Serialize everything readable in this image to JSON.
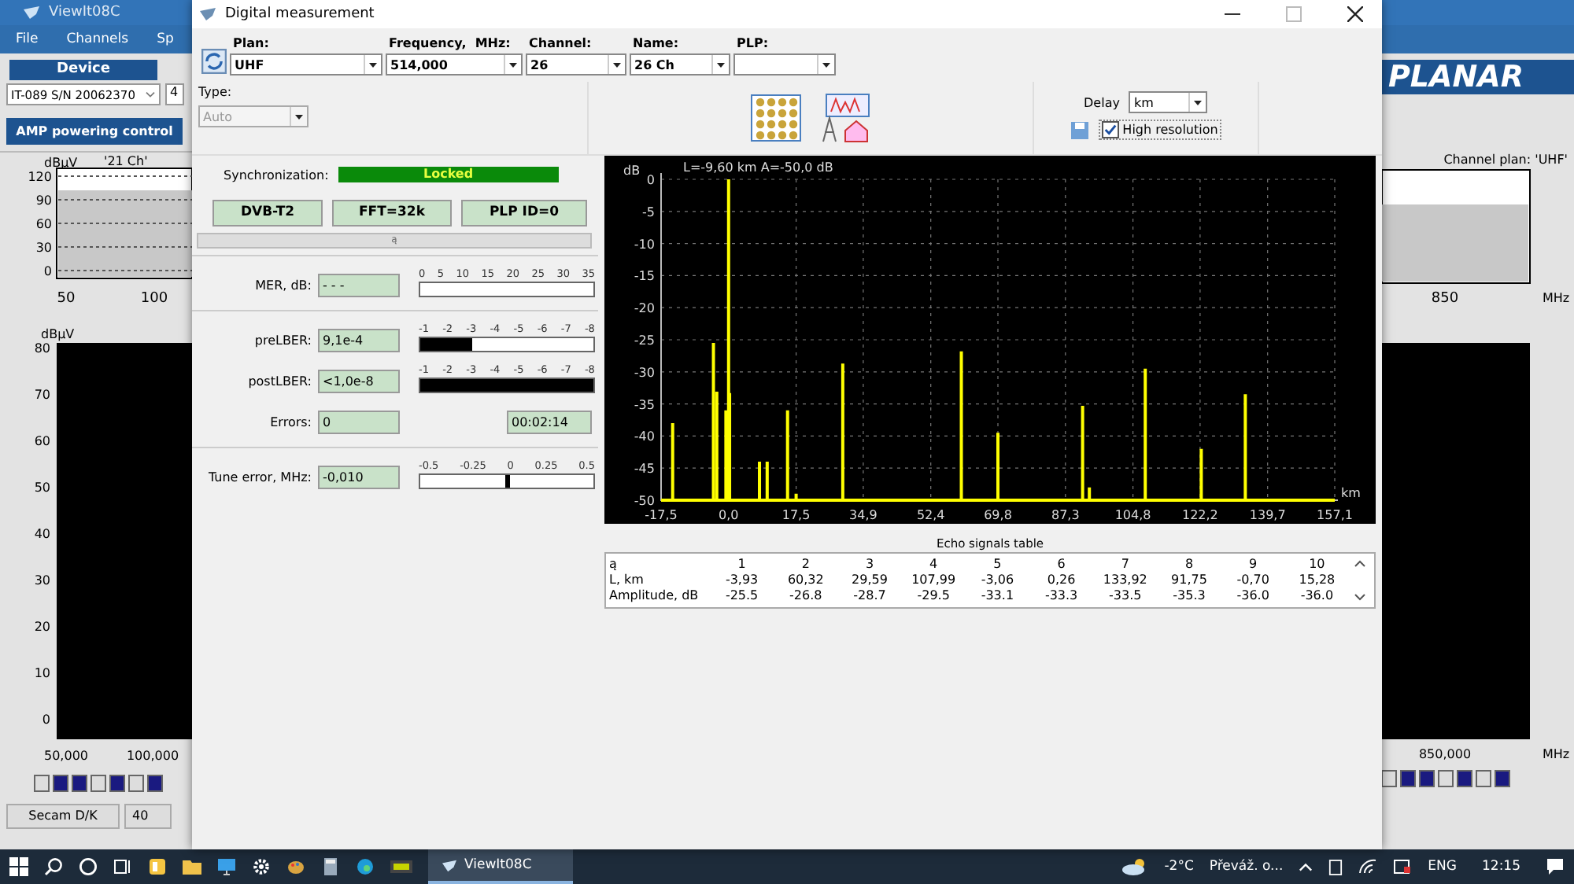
{
  "app": {
    "title": "ViewIt08C",
    "menu": [
      "File",
      "Channels",
      "Sp"
    ],
    "device_label": "Device",
    "device": "IT-089 S/N 20062370",
    "device_partial": "4",
    "amp_button": "AMP powering control",
    "left_spectrum": {
      "unit": "dBµV",
      "marker": "'21 Ch'",
      "yticks": [
        "120",
        "90",
        "60",
        "30",
        "0"
      ],
      "xticks": [
        "50",
        "100"
      ]
    },
    "left_levels": {
      "unit": "dBµV",
      "yticks": [
        "80",
        "70",
        "60",
        "50",
        "40",
        "30",
        "20",
        "10",
        "0"
      ],
      "xticks": [
        "50,000",
        "100,000"
      ]
    },
    "standard": "Secam D/K",
    "standard_partial": "40",
    "logo": "PLANAR",
    "channel_plan": "Channel plan: 'UHF'",
    "right_spectrum": {
      "xticks": [
        "850"
      ],
      "unit": "MHz"
    },
    "right_levels": {
      "xticks": [
        "850,000"
      ],
      "unit": "MHz"
    }
  },
  "dialog": {
    "title": "Digital measurement",
    "fields": [
      {
        "label": "Plan:",
        "value": "UHF"
      },
      {
        "label": "Frequency,  MHz:",
        "value": "514,000"
      },
      {
        "label": "Channel:",
        "value": "26"
      },
      {
        "label": "Name:",
        "value": "26 Ch"
      },
      {
        "label": "PLP:"
      }
    ],
    "type": {
      "label": "Type:",
      "value": "Auto",
      "disabled": true
    },
    "delay": {
      "label": "Delay",
      "value": "km"
    },
    "high_resolution": {
      "label": "High resolution",
      "checked": true
    },
    "sync": {
      "label": "Synchronization:",
      "value": "Locked",
      "locked": true
    },
    "modes": [
      "DVB-T2",
      "FFT=32k",
      "PLP ID=0"
    ],
    "divider_label": "ą",
    "sections": [
      [
        {
          "kind": "meter",
          "label": "MER, dB:",
          "reading": "- - -",
          "scale": [
            "0",
            "5",
            "10",
            "15",
            "20",
            "25",
            "30",
            "35"
          ]
        }
      ],
      [
        {
          "kind": "meter",
          "label": "preLBER:",
          "reading": "9,1e-4",
          "scale": [
            "-1",
            "-2",
            "-3",
            "-4",
            "-5",
            "-6",
            "-7",
            "-8"
          ],
          "level": 0.3
        },
        {
          "kind": "meter",
          "label": "postLBER:",
          "reading": "<1,0e-8",
          "scale": [
            "-1",
            "-2",
            "-3",
            "-4",
            "-5",
            "-6",
            "-7",
            "-8"
          ],
          "level": 1
        },
        {
          "kind": "counter",
          "label": "Errors:",
          "reading": "0",
          "timer": "00:02:14"
        }
      ],
      [
        {
          "kind": "marker",
          "label": "Tune error, MHz:",
          "reading": "-0,010",
          "scale": [
            "-0.5",
            "-0.25",
            "0",
            "0.25",
            "0.5"
          ],
          "level": 0.49
        }
      ]
    ],
    "echo_chart": {
      "readout": "L=-9,60 km   A=-50,0 dB",
      "chart_data": {
        "type": "line",
        "xlabel": "km",
        "ylabel": "dB",
        "grid": true,
        "x": [
          -17.5,
          -14.5,
          -14.5,
          -14.5,
          -3.93,
          -3.93,
          -3.93,
          -3.06,
          -3.06,
          -3.06,
          -0.7,
          -0.7,
          -0.7,
          0,
          0,
          0,
          0.26,
          0.26,
          0.26,
          8,
          8,
          8,
          10,
          10,
          10,
          15.28,
          15.28,
          15.28,
          17.5,
          17.5,
          17.5,
          29.59,
          29.59,
          29.59,
          60.32,
          60.32,
          60.32,
          69.8,
          69.8,
          69.8,
          91.75,
          91.75,
          91.75,
          93.5,
          93.5,
          93.5,
          107.99,
          107.99,
          107.99,
          122.5,
          122.5,
          122.5,
          133.92,
          133.92,
          133.92,
          157.1
        ],
        "series": [
          {
            "color": "#ffff00",
            "values": [
              -50,
              -50,
              -38,
              -50,
              -50,
              -25.5,
              -50,
              -50,
              -33.1,
              -50,
              -50,
              -36,
              -50,
              -50,
              0,
              -50,
              -50,
              -33.3,
              -50,
              -50,
              -44,
              -50,
              -50,
              -44,
              -50,
              -50,
              -36,
              -50,
              -50,
              -49,
              -50,
              -50,
              -28.7,
              -50,
              -50,
              -26.8,
              -50,
              -50,
              -39.5,
              -50,
              -50,
              -35.3,
              -50,
              -50,
              -48,
              -50,
              -50,
              -29.5,
              -50,
              -50,
              -42,
              -50,
              -50,
              -33.5,
              -50,
              -50
            ]
          }
        ],
        "xlim": [
          -17.5,
          157.1
        ],
        "ylim": [
          -50,
          0
        ],
        "xticks": [
          {
            "value": -17.5,
            "label": "-17,5"
          },
          {
            "value": 0,
            "label": "0,0"
          },
          {
            "value": 17.5,
            "label": "17,5"
          },
          {
            "value": 34.9,
            "label": "34,9"
          },
          {
            "value": 52.4,
            "label": "52,4"
          },
          {
            "value": 69.8,
            "label": "69,8"
          },
          {
            "value": 87.3,
            "label": "87,3"
          },
          {
            "value": 104.8,
            "label": "104,8"
          },
          {
            "value": 122.2,
            "label": "122,2"
          },
          {
            "value": 139.7,
            "label": "139,7"
          },
          {
            "value": 157.1,
            "label": "157,1"
          }
        ],
        "yticks": [
          0,
          -5,
          -10,
          -15,
          -20,
          -25,
          -30,
          -35,
          -40,
          -45,
          -50
        ]
      }
    },
    "echo_table": {
      "title": "Echo signals table",
      "rows": [
        {
          "header": "ą",
          "cells": [
            "1",
            "2",
            "3",
            "4",
            "5",
            "6",
            "7",
            "8",
            "9",
            "10"
          ]
        },
        {
          "header": "L, km",
          "cells": [
            "-3,93",
            "60,32",
            "29,59",
            "107,99",
            "-3,06",
            "0,26",
            "133,92",
            "91,75",
            "-0,70",
            "15,28"
          ]
        },
        {
          "header": "Amplitude, dB",
          "cells": [
            "-25.5",
            "-26.8",
            "-28.7",
            "-29.5",
            "-33.1",
            "-33.3",
            "-33.5",
            "-35.3",
            "-36.0",
            "-36.0"
          ]
        }
      ]
    }
  },
  "taskbar": {
    "app_button": "ViewIt08C",
    "temperature": "-2°C",
    "weather": "Převáž. o...",
    "language": "ENG",
    "time": "12:15"
  }
}
